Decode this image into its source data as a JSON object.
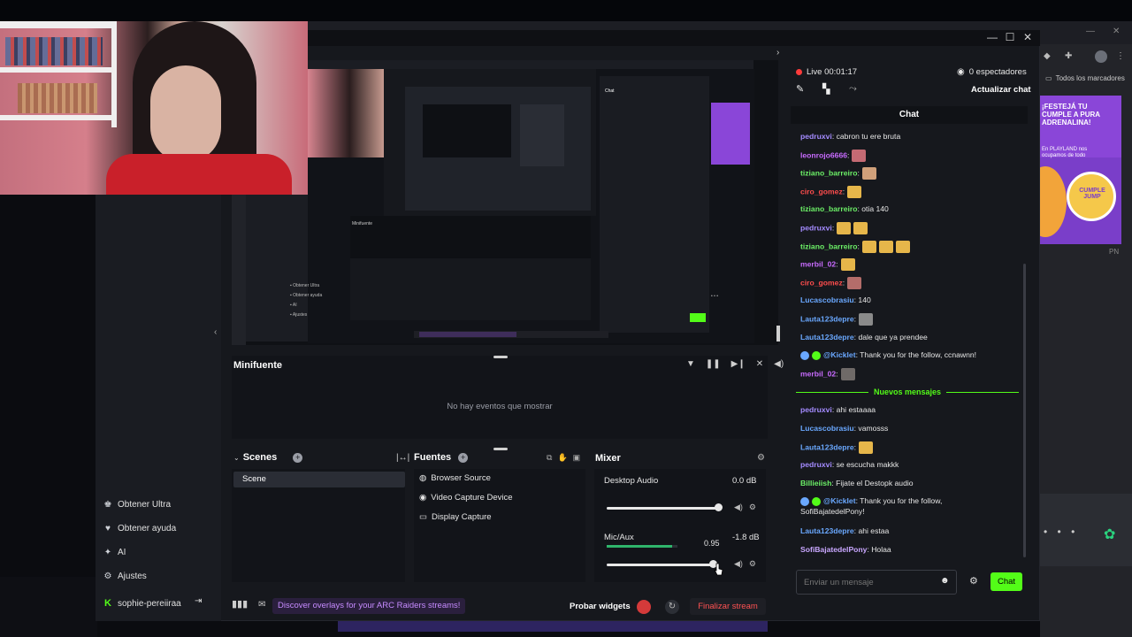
{
  "browser": {
    "bookmarks_label": "Todos los marcadores",
    "promo": {
      "line1": "¡FESTEJÁ TU",
      "line2": "CUMPLE A PURA",
      "line3": "ADRENALINA!",
      "line4": "En PLAYLAND nos",
      "line5": "ocupamos de todo",
      "brand": "CUMPLE JUMP",
      "corner": "PN"
    }
  },
  "window": {
    "min_icon": "minimize-icon",
    "max_icon": "maximize-icon",
    "close_icon": "close-icon"
  },
  "sidebar": {
    "items": [
      {
        "label": "Obtener Ultra",
        "icon": "gift-icon"
      },
      {
        "label": "Obtener ayuda",
        "icon": "help-icon"
      },
      {
        "label": "AI",
        "icon": "sparkle-icon"
      },
      {
        "label": "Ajustes",
        "icon": "gear-icon"
      }
    ],
    "user": "sophie-pereiiraa"
  },
  "status": {
    "live": "Live 00:01:17",
    "viewers": "0 espectadores",
    "refresh_chat": "Actualizar chat"
  },
  "minifuente": {
    "title": "Minifuente",
    "empty": "No hay eventos que mostrar"
  },
  "scenes": {
    "title": "Scenes",
    "items": [
      "Scene"
    ]
  },
  "sources": {
    "title": "Fuentes",
    "items": [
      {
        "label": "Browser Source",
        "icon": "globe-icon"
      },
      {
        "label": "Video Capture Device",
        "icon": "camera-icon"
      },
      {
        "label": "Display Capture",
        "icon": "monitor-icon"
      }
    ]
  },
  "mixer": {
    "title": "Mixer",
    "channels": [
      {
        "name": "Desktop Audio",
        "db": "0.0 dB",
        "level": 1.0
      },
      {
        "name": "Mic/Aux",
        "db": "-1.8 dB",
        "level": 0.95,
        "tooltip": "0.95"
      }
    ]
  },
  "chat": {
    "title": "Chat",
    "new_messages": "Nuevos mensajes",
    "input_placeholder": "Enviar un mensaje",
    "send_label": "Chat",
    "messages_before": [
      {
        "user": "pedruxvi",
        "color": "#a48bff",
        "text": ": cabron tu ere bruta"
      },
      {
        "user": "leonrojo6666",
        "color": "#c86bff",
        "text": ":",
        "emote": "#c46a73"
      },
      {
        "user": "tiziano_barreiro",
        "color": "#6cf067",
        "text": ":",
        "emote": "#d0a07a"
      },
      {
        "user": "ciro_gomez",
        "color": "#ff4d4d",
        "text": ":",
        "emote": "#e6b64a"
      },
      {
        "user": "tiziano_barreiro",
        "color": "#6cf067",
        "text": ": otia 140"
      },
      {
        "user": "pedruxvi",
        "color": "#a48bff",
        "text": ":",
        "emote": "#e6b64a",
        "emote2": "#e6b64a"
      },
      {
        "user": "tiziano_barreiro",
        "color": "#6cf067",
        "text": ":",
        "emote": "#e6b64a",
        "emote2": "#e6b64a",
        "emote3": "#e6b64a"
      },
      {
        "user": "merbil_02",
        "color": "#c86bff",
        "text": ":",
        "emote": "#e6b64a"
      },
      {
        "user": "ciro_gomez",
        "color": "#ff4d4d",
        "text": ":",
        "emote": "#b46d6a"
      },
      {
        "user": "Lucascobrasiu",
        "color": "#6aa8ff",
        "text": ": 140"
      },
      {
        "user": "Lauta123depre",
        "color": "#6aa8ff",
        "text": ":",
        "emote": "#8a8a8a"
      },
      {
        "user": "Lauta123depre",
        "color": "#6aa8ff",
        "text": ": dale que ya prendee"
      },
      {
        "user": "@Kicklet",
        "color": "#6aa8ff",
        "text": ": Thank you for the follow, ccnawnn!",
        "bot": true
      },
      {
        "user": "merbil_02",
        "color": "#c86bff",
        "text": ":",
        "emote": "#6f6a68"
      }
    ],
    "messages_after": [
      {
        "user": "pedruxvi",
        "color": "#a48bff",
        "text": ": ahi estaaaa"
      },
      {
        "user": "Lucascobrasiu",
        "color": "#6aa8ff",
        "text": ": vamosss"
      },
      {
        "user": "Lauta123depre",
        "color": "#6aa8ff",
        "text": ":",
        "emote": "#e6b64a"
      },
      {
        "user": "pedruxvi",
        "color": "#a48bff",
        "text": ": se escucha makkk"
      },
      {
        "user": "Billieiish",
        "color": "#6cf067",
        "text": ": Fijate el Destopk audio"
      },
      {
        "user": "@Kicklet",
        "color": "#6aa8ff",
        "text": ": Thank you for the follow,",
        "text2": "SofiBajatedelPony!",
        "bot": true
      },
      {
        "user": "Lauta123depre",
        "color": "#6aa8ff",
        "text": ": ahi estaa"
      },
      {
        "user": "SofiBajatedelPony",
        "color": "#c9a7ff",
        "text": ": Holaa"
      }
    ]
  },
  "bottom_bar": {
    "discover": "Discover overlays for your ARC Raiders streams!",
    "probar": "Probar widgets",
    "end_stream": "Finalizar stream"
  },
  "colors": {
    "accent_green": "#53fc18",
    "live_red": "#ff3b3b",
    "end_red": "#ff5252",
    "panel": "#121419"
  }
}
